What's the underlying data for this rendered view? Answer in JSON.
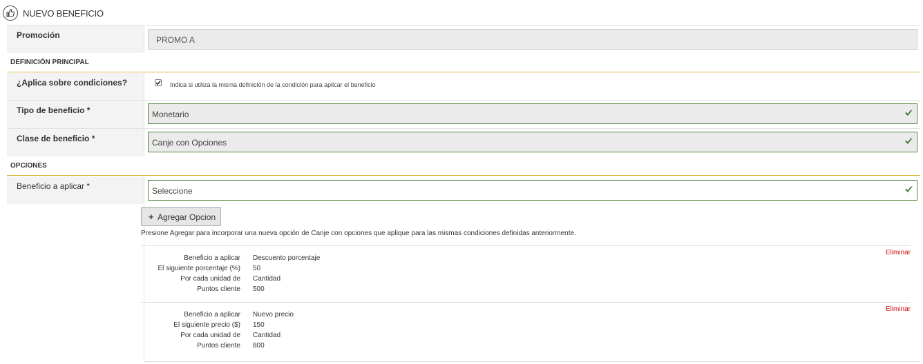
{
  "header": {
    "title": "NUEVO BENEFICIO",
    "icon": "thumbs-up-icon"
  },
  "promocion": {
    "label": "Promoción",
    "value": "PROMO A"
  },
  "sections": {
    "principal": "DEFINICIÓN PRINCIPAL",
    "opciones": "OPCIONES"
  },
  "aplica": {
    "label": "¿Aplica sobre condiciones?",
    "checked": true,
    "help": "Indica si utiliza la misma definición de la condición para aplicar el beneficio"
  },
  "tipo": {
    "label": "Tipo de beneficio *",
    "value": "Monetario"
  },
  "clase": {
    "label": "Clase de beneficio *",
    "value": "Canje con Opciones"
  },
  "beneficio": {
    "label": "Beneficio a aplicar *",
    "value": "Seleccione"
  },
  "add_button": {
    "label": "Agregar Opcion"
  },
  "hint": "Presione Agregar para incorporar una nueva opción de Canje con opciones que aplique para las mismas condiciones definidas anteriormente.",
  "options": [
    {
      "delete_label": "Eliminar",
      "rows": [
        {
          "key": "Beneficio a aplicar",
          "value": "Descuento porcentaje"
        },
        {
          "key": "El siguiente porcentaje (%)",
          "value": "50"
        },
        {
          "key": "Por cada unidad de",
          "value": "Cantidad"
        },
        {
          "key": "Puntos cliente",
          "value": "500"
        }
      ]
    },
    {
      "delete_label": "Eliminar",
      "rows": [
        {
          "key": "Beneficio a aplicar",
          "value": "Nuevo precio"
        },
        {
          "key": "El siguiente precio ($)",
          "value": "150"
        },
        {
          "key": "Por cada unidad de",
          "value": "Cantidad"
        },
        {
          "key": "Puntos cliente",
          "value": "800"
        }
      ]
    }
  ],
  "colors": {
    "accent_gold": "#d8b93f",
    "field_green": "#4e8a3c",
    "delete_red": "#d01010"
  }
}
